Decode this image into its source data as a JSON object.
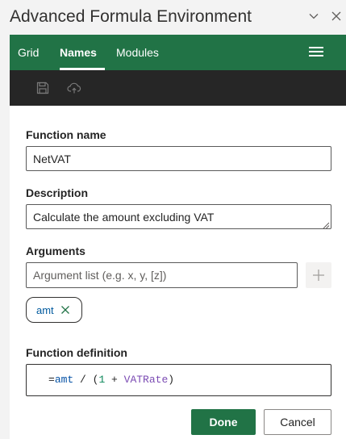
{
  "window": {
    "title": "Advanced Formula Environment",
    "chevron_icon": "chevron-down-icon",
    "close_icon": "close-icon"
  },
  "nav": {
    "tabs": [
      {
        "label": "Grid",
        "active": false
      },
      {
        "label": "Names",
        "active": true
      },
      {
        "label": "Modules",
        "active": false
      }
    ],
    "menu_icon": "hamburger-menu-icon",
    "accent": "#217346"
  },
  "toolbar": {
    "save_icon": "save-icon",
    "cloud_icon": "cloud-upload-icon",
    "background": "#262626"
  },
  "form": {
    "function_name_label": "Function name",
    "function_name_value": "NetVAT",
    "description_label": "Description",
    "description_value": "Calculate the amount excluding VAT",
    "arguments_label": "Arguments",
    "arguments_placeholder": "Argument list (e.g. x, y, [z])",
    "arguments_value": "",
    "add_icon": "plus-icon",
    "chips": [
      {
        "label": "amt",
        "remove_icon": "remove-x-icon"
      }
    ],
    "definition_label": "Function definition",
    "definition_tokens": {
      "eq": "=",
      "arg": "amt",
      "div": " / (",
      "one": "1",
      "plus": " + ",
      "name": "VATRate",
      "close": ")"
    }
  },
  "actions": {
    "done_label": "Done",
    "cancel_label": "Cancel"
  }
}
